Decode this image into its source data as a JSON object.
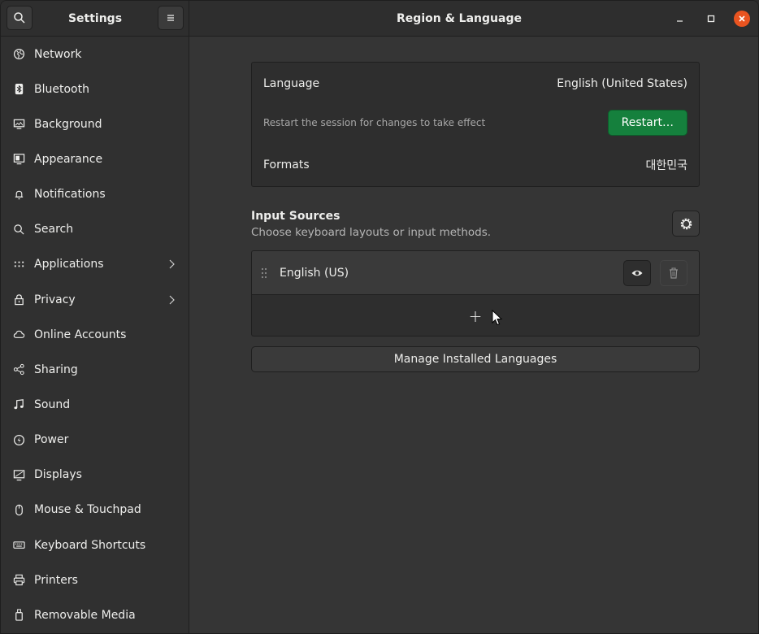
{
  "header": {
    "settings_title": "Settings",
    "main_title": "Region & Language"
  },
  "sidebar": {
    "items": [
      {
        "label": "Network",
        "icon": "network-icon"
      },
      {
        "label": "Bluetooth",
        "icon": "bluetooth-icon"
      },
      {
        "label": "Background",
        "icon": "background-icon"
      },
      {
        "label": "Appearance",
        "icon": "appearance-icon"
      },
      {
        "label": "Notifications",
        "icon": "notifications-icon"
      },
      {
        "label": "Search",
        "icon": "search-icon"
      },
      {
        "label": "Applications",
        "icon": "applications-icon",
        "chevron": true
      },
      {
        "label": "Privacy",
        "icon": "privacy-icon",
        "chevron": true
      },
      {
        "label": "Online Accounts",
        "icon": "cloud-icon"
      },
      {
        "label": "Sharing",
        "icon": "share-icon"
      },
      {
        "label": "Sound",
        "icon": "music-note-icon"
      },
      {
        "label": "Power",
        "icon": "power-icon"
      },
      {
        "label": "Displays",
        "icon": "display-icon"
      },
      {
        "label": "Mouse & Touchpad",
        "icon": "mouse-icon"
      },
      {
        "label": "Keyboard Shortcuts",
        "icon": "keyboard-icon"
      },
      {
        "label": "Printers",
        "icon": "printer-icon"
      },
      {
        "label": "Removable Media",
        "icon": "usb-drive-icon"
      }
    ]
  },
  "language_card": {
    "language_label": "Language",
    "language_value": "English (United States)",
    "restart_note": "Restart the session for changes to take effect",
    "restart_button": "Restart…",
    "formats_label": "Formats",
    "formats_value": "대한민국"
  },
  "input_sources": {
    "title": "Input Sources",
    "subtitle": "Choose keyboard layouts or input methods.",
    "sources": [
      {
        "label": "English (US)"
      }
    ],
    "add_symbol": "+"
  },
  "manage_button": "Manage Installed Languages",
  "colors": {
    "accent_green": "#15803d",
    "close_orange": "#e95420"
  }
}
